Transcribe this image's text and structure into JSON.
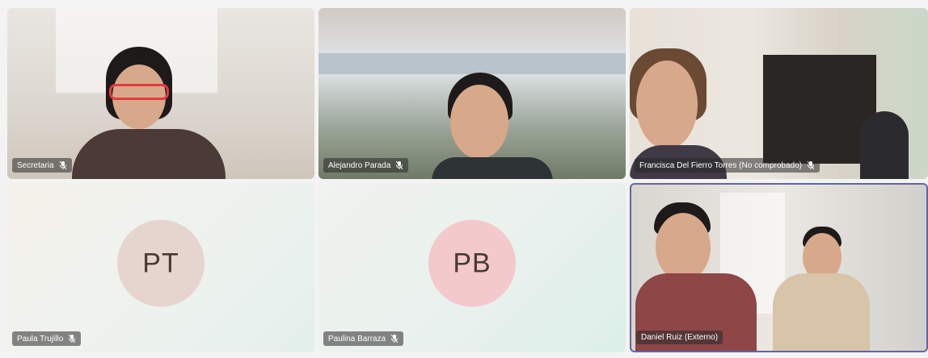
{
  "participants": [
    {
      "name": "Secretaria",
      "initials": "",
      "muted": true
    },
    {
      "name": "Alejandro Parada",
      "initials": "",
      "muted": true
    },
    {
      "name": "Francisca Del Fierro Torres (No comprobado)",
      "initials": "",
      "muted": true
    },
    {
      "name": "Paula Trujillo",
      "initials": "PT",
      "muted": true
    },
    {
      "name": "Paulina Barraza",
      "initials": "PB",
      "muted": true
    },
    {
      "name": "Daniel Ruiz (Externo)",
      "initials": "",
      "muted": false
    }
  ],
  "colors": {
    "active_speaker_border": "#6264a7",
    "avatar_pt": "#e6d5cf",
    "avatar_pb": "#f3c9cc"
  },
  "icons": {
    "muted": "mic-off-icon"
  }
}
